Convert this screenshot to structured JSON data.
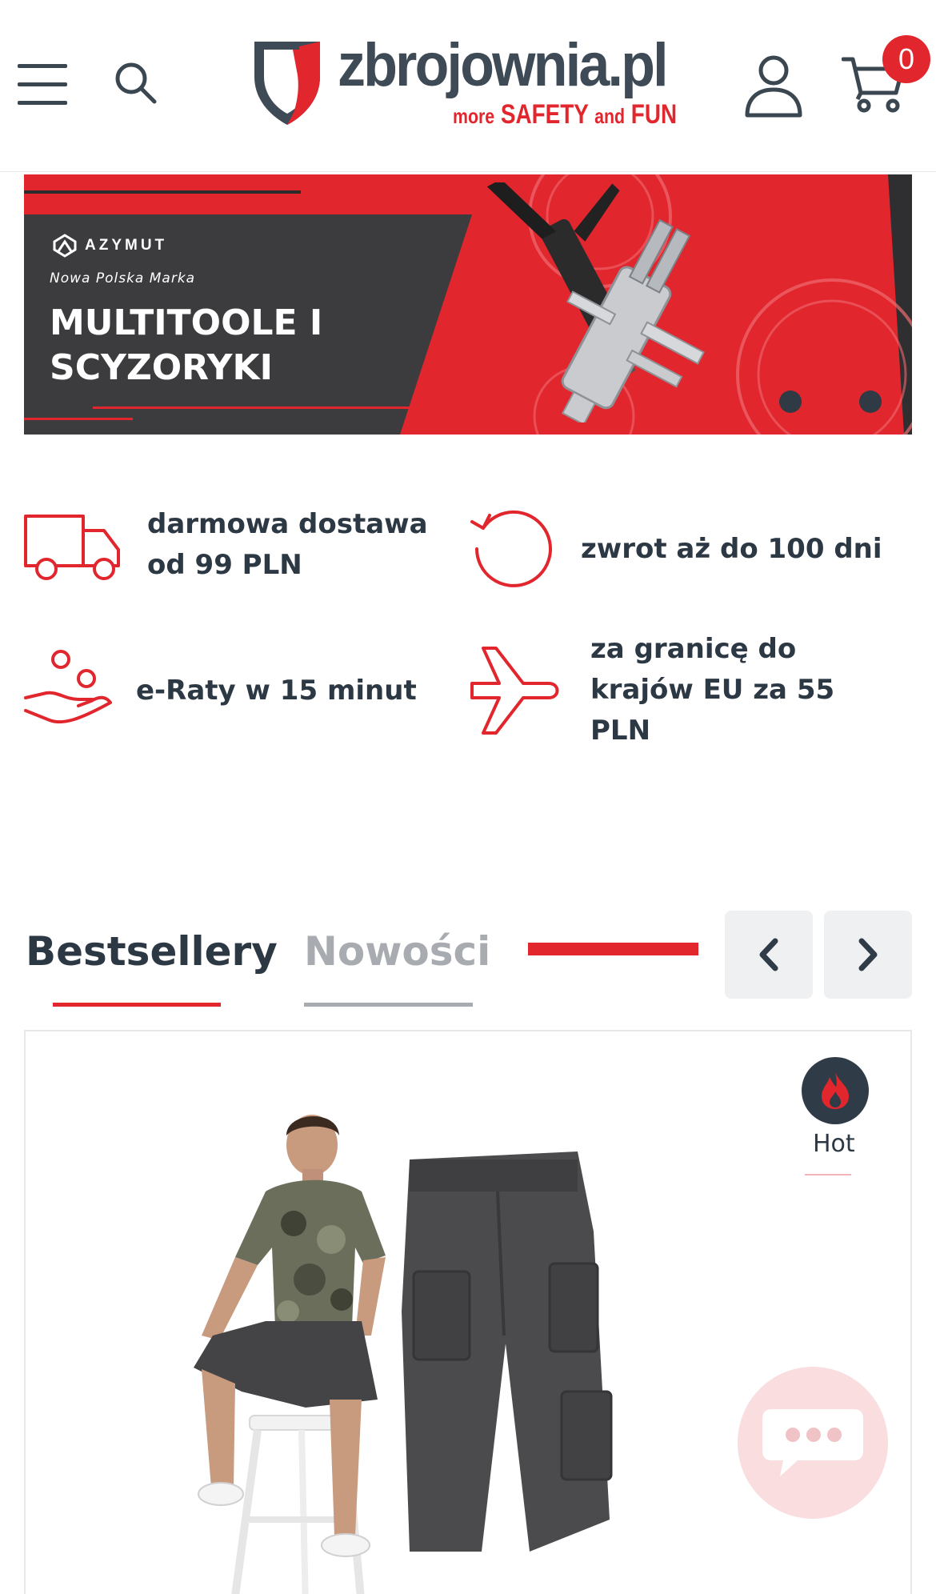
{
  "header": {
    "logo": {
      "name": "zbrojownia.pl",
      "tagline_more": "more",
      "tagline_safety": "SAFETY",
      "tagline_and": "and",
      "tagline_fun": "FUN"
    },
    "cart_count": "0",
    "icons": [
      "menu-icon",
      "search-icon",
      "user-icon",
      "cart-icon"
    ]
  },
  "banner": {
    "brand": "AZYMUT",
    "subtitle": "Nowa Polska Marka",
    "title": "MULTITOOLE I SCYZORYKI",
    "slides": 2
  },
  "benefits": [
    {
      "icon": "truck-icon",
      "text": "darmowa dostawa od 99 PLN"
    },
    {
      "icon": "return-icon",
      "text": "zwrot aż do 100 dni"
    },
    {
      "icon": "hand-coins-icon",
      "text": "e-Raty w 15 minut"
    },
    {
      "icon": "plane-icon",
      "text": "za granicę do krajów EU za 55 PLN"
    }
  ],
  "tabs": [
    {
      "label": "Bestsellery",
      "active": true
    },
    {
      "label": "Nowości",
      "active": false
    }
  ],
  "product": {
    "badge": "Hot"
  },
  "colors": {
    "accent": "#e1262d",
    "text": "#2c3843",
    "muted": "#a8acb0",
    "dark": "#2f3b46"
  }
}
